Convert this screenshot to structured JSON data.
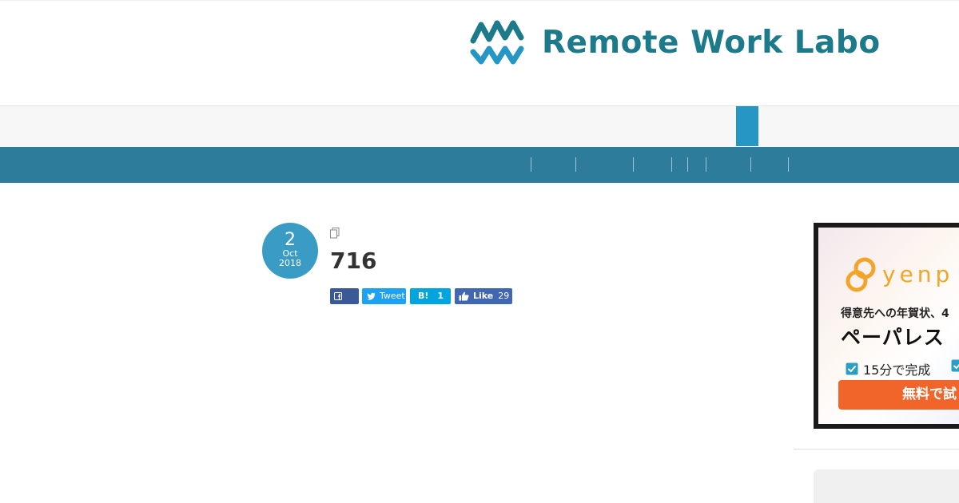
{
  "site": {
    "name": "Remote Work Labo",
    "brand_color": "#1d7a8a",
    "nav_color": "#2e7c9c",
    "active_tab_color": "#2697c4"
  },
  "post": {
    "date": {
      "day": "2",
      "month": "Oct",
      "year": "2018"
    },
    "title": "716",
    "icon": "copy-icon"
  },
  "share": {
    "facebook": {
      "icon": "facebook-icon",
      "label": ""
    },
    "twitter": {
      "icon": "twitter-icon",
      "label": "Tweet"
    },
    "hatena": {
      "label": "B!",
      "count": "1"
    },
    "like": {
      "icon": "thumbs-up-icon",
      "label": "Like",
      "count": "29"
    }
  },
  "ad": {
    "brand": "yenp",
    "line1": "得意先への年賀状、4",
    "line2": "ペーパレス",
    "check1": "15分で完成",
    "cta": "無料で試"
  }
}
